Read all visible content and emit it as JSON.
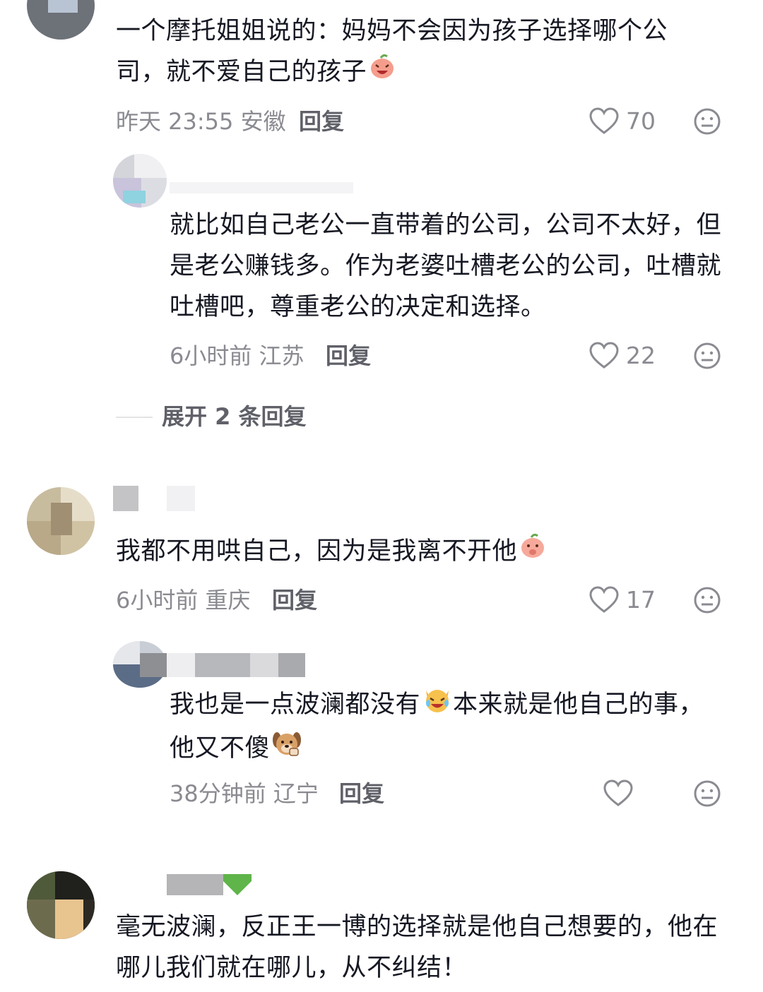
{
  "comments": [
    {
      "text": "一个摩托姐姐说的：妈妈不会因为孩子选择哪个公司，就不爱自己的孩子",
      "time": "昨天 23:55",
      "location": "安徽",
      "reply_label": "回复",
      "likes": "70"
    },
    {
      "text": "就比如自己老公一直带着的公司，公司不太好，但是老公赚钱多。作为老婆吐槽老公的公司，吐槽就吐槽吧，尊重老公的决定和选择。",
      "time": "6小时前",
      "location": "江苏",
      "reply_label": "回复",
      "likes": "22"
    },
    {
      "text": "我都不用哄自己，因为是我离不开他",
      "time": "6小时前",
      "location": "重庆",
      "reply_label": "回复",
      "likes": "17"
    },
    {
      "text_before": "我也是一点波澜都没有",
      "text_after": "本来就是他自己的事，他又不傻",
      "time": "38分钟前",
      "location": "辽宁",
      "reply_label": "回复",
      "likes": ""
    },
    {
      "text": "毫无波澜，反正王一博的选择就是他自己想要的，他在哪儿我们就在哪儿，从不纠结！"
    }
  ],
  "expand_replies": "展开 2 条回复",
  "icons": {
    "like": "heart-outline-icon",
    "dislike": "meh-face-icon"
  },
  "colors": {
    "text": "#161823",
    "meta": "#8a8b91",
    "reply": "#5f6068"
  }
}
